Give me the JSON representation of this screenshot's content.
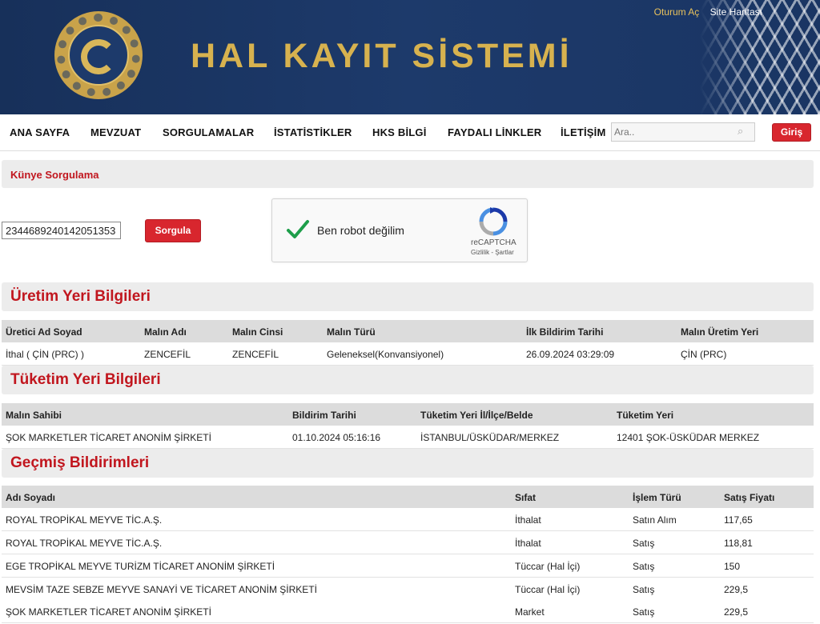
{
  "header": {
    "title": "HAL KAYIT SİSTEMİ",
    "top_links": {
      "login": "Oturum Aç",
      "sitemap": "Site Haritası"
    },
    "colors": {
      "banner": "#1d3a6b",
      "gold": "#d7b24f",
      "accent_red": "#c1161e"
    }
  },
  "nav": {
    "items": [
      "ANA SAYFA",
      "MEVZUAT",
      "SORGULAMALAR",
      "İSTATİSTİKLER",
      "HKS BİLGİ",
      "FAYDALI LİNKLER",
      "İLETİŞİM"
    ],
    "search_placeholder": "Ara..",
    "login_button": "Giriş"
  },
  "kunye": {
    "title": "Künye Sorgulama",
    "input_value": "2344689240142051353",
    "query_button": "Sorgula",
    "captcha": {
      "label": "Ben robot değilim",
      "brand": "reCAPTCHA",
      "links": "Gizlilik - Şartlar"
    }
  },
  "uretim": {
    "title": "Üretim Yeri Bilgileri",
    "headers": [
      "Üretici Ad Soyad",
      "Malın Adı",
      "Malın Cinsi",
      "Malın Türü",
      "İlk Bildirim Tarihi",
      "Malın Üretim Yeri"
    ],
    "rows": [
      [
        "İthal ( ÇİN (PRC) )",
        "ZENCEFİL",
        "ZENCEFİL",
        "Geleneksel(Konvansiyonel)",
        "26.09.2024 03:29:09",
        "ÇİN (PRC)"
      ]
    ]
  },
  "tuketim": {
    "title": "Tüketim Yeri Bilgileri",
    "headers": [
      "Malın Sahibi",
      "Bildirim Tarihi",
      "Tüketim Yeri İl/İlçe/Belde",
      "Tüketim Yeri"
    ],
    "rows": [
      [
        "ŞOK MARKETLER TİCARET ANONİM ŞİRKETİ",
        "01.10.2024 05:16:16",
        "İSTANBUL/ÜSKÜDAR/MERKEZ",
        "12401 ŞOK-ÜSKÜDAR MERKEZ"
      ]
    ]
  },
  "gecmis": {
    "title": "Geçmiş Bildirimleri",
    "headers": [
      "Adı Soyadı",
      "Sıfat",
      "İşlem Türü",
      "Satış Fiyatı"
    ],
    "rows": [
      [
        "ROYAL TROPİKAL MEYVE TİC.A.Ş.",
        "İthalat",
        "Satın Alım",
        "117,65"
      ],
      [
        "ROYAL TROPİKAL MEYVE TİC.A.Ş.",
        "İthalat",
        "Satış",
        "118,81"
      ],
      [
        "EGE TROPİKAL MEYVE TURİZM TİCARET ANONİM ŞİRKETİ",
        "Tüccar (Hal İçi)",
        "Satış",
        "150"
      ],
      [
        "MEVSİM TAZE SEBZE MEYVE SANAYİ VE TİCARET ANONİM ŞİRKETİ",
        "Tüccar (Hal İçi)",
        "Satış",
        "229,5"
      ],
      [
        "ŞOK MARKETLER TİCARET ANONİM ŞİRKETİ",
        "Market",
        "Satış",
        "229,5"
      ]
    ]
  }
}
